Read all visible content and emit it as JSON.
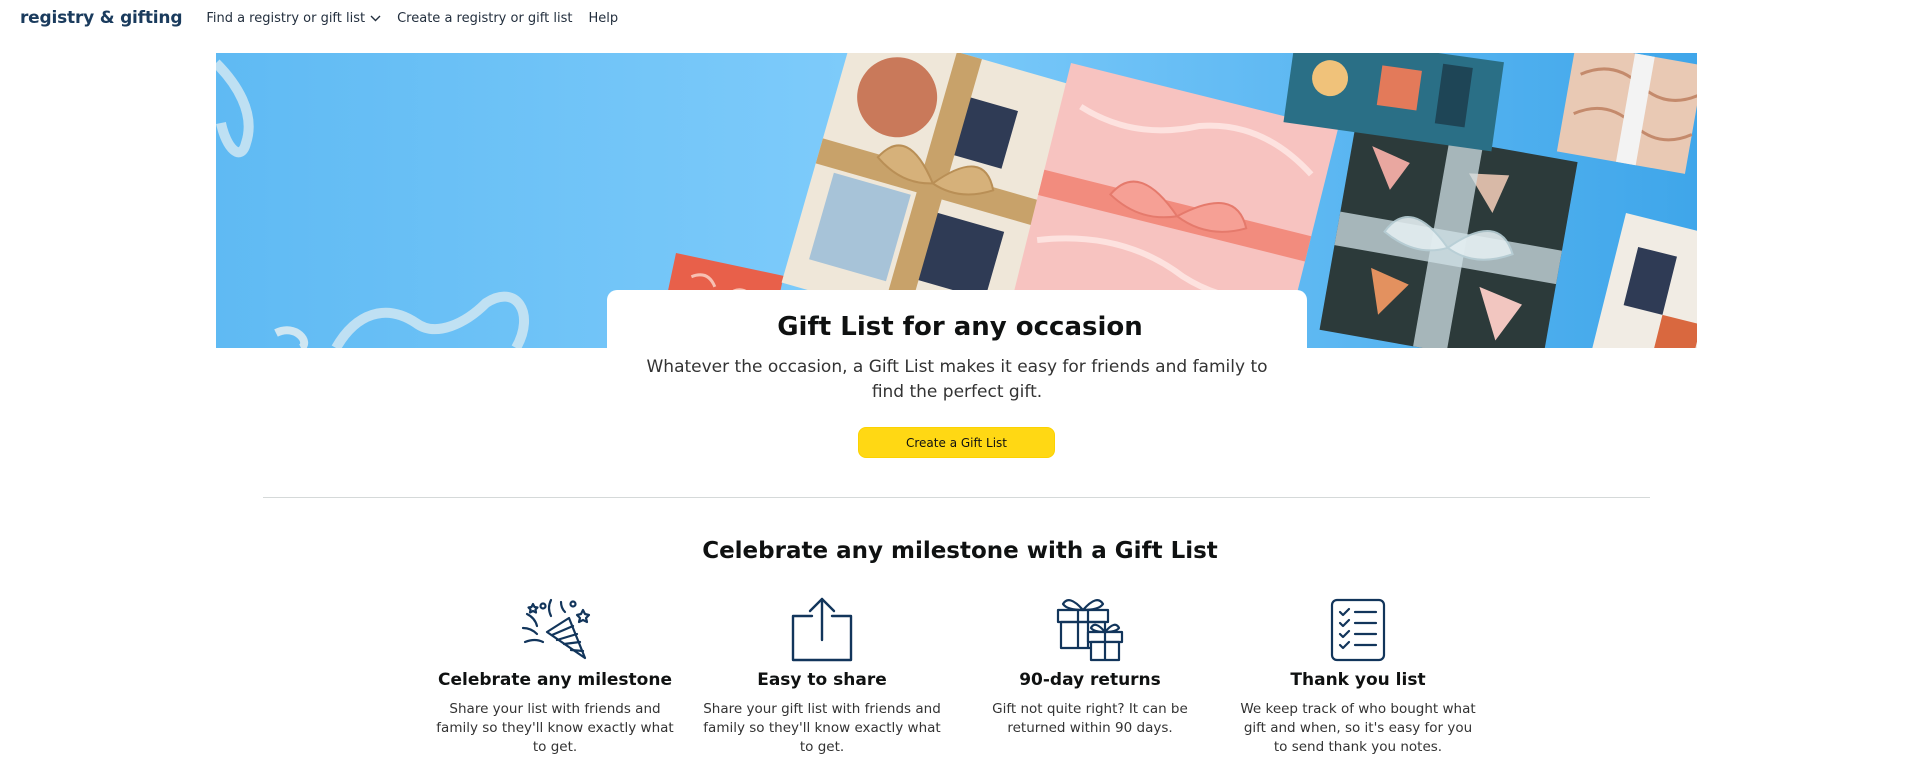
{
  "nav": {
    "brand": "registry & gifting",
    "find_label": "Find a registry or gift list",
    "create_label": "Create a registry or gift list",
    "help_label": "Help"
  },
  "hero": {
    "title": "Gift List for any occasion",
    "subtitle": "Whatever the occasion, a Gift List makes it easy for friends and family to find the perfect gift.",
    "cta_label": "Create a Gift List"
  },
  "section": {
    "title": "Celebrate any milestone with a Gift List"
  },
  "features": [
    {
      "icon": "party-hat-icon",
      "title": "Celebrate any milestone",
      "desc": "Share your list with friends and family so they'll know exactly what to get."
    },
    {
      "icon": "share-icon",
      "title": "Easy to share",
      "desc": "Share your gift list with friends and family so they'll know exactly what to get."
    },
    {
      "icon": "gift-boxes-icon",
      "title": "90-day returns",
      "desc": "Gift not quite right? It can be returned within 90 days."
    },
    {
      "icon": "checklist-icon",
      "title": "Thank you list",
      "desc": "We keep track of who bought what gift and when, so it's easy for you to send thank you notes."
    }
  ],
  "colors": {
    "brand_text": "#1a3b5d",
    "cta_yellow": "#ffd814",
    "hero_blue": "#5cb8f2",
    "icon_navy": "#12355b"
  }
}
